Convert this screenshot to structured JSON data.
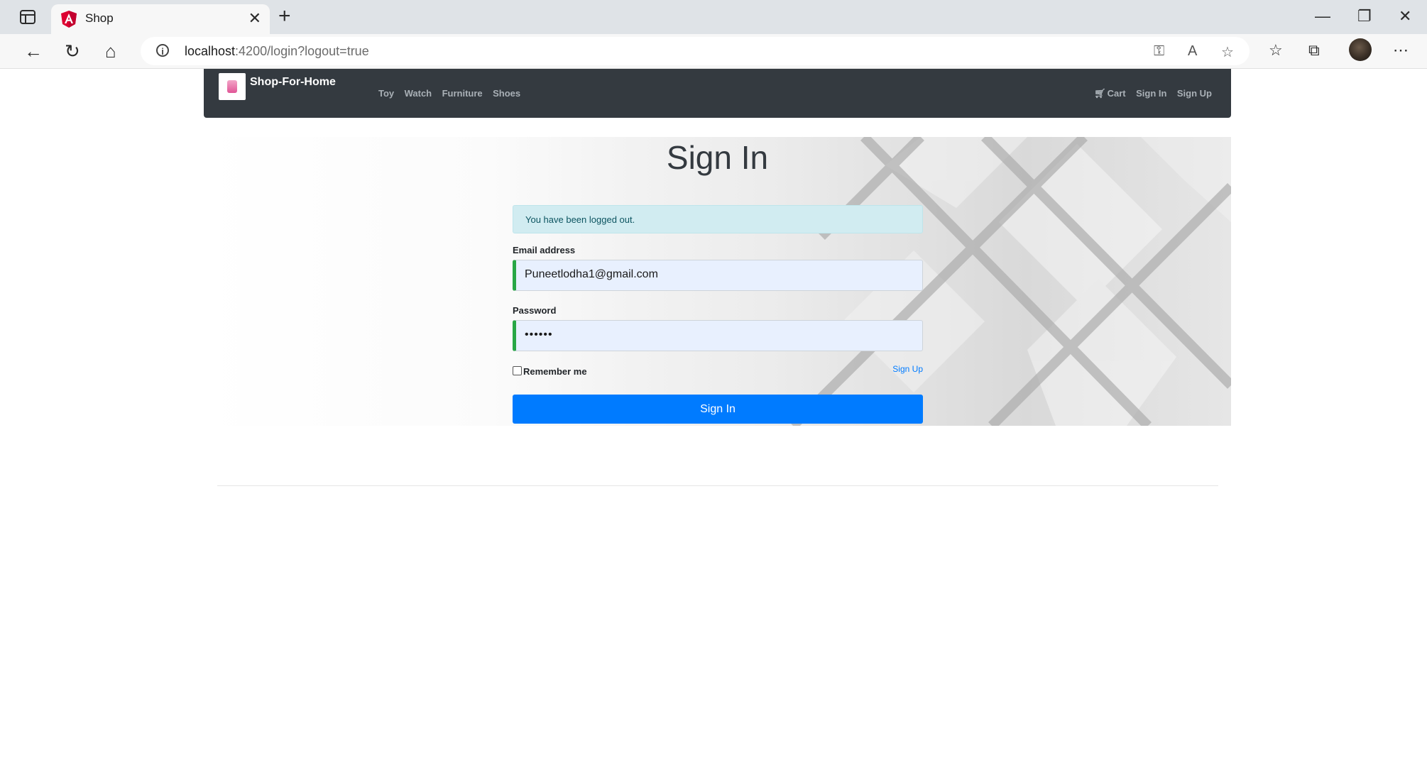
{
  "browser": {
    "tab_title": "Shop",
    "url_host": "localhost",
    "url_rest": ":4200/login?logout=true"
  },
  "navbar": {
    "brand": "Shop-For-Home",
    "links": [
      "Toy",
      "Watch",
      "Furniture",
      "Shoes"
    ],
    "right_links": {
      "cart": "Cart",
      "sign_in": "Sign In",
      "sign_up": "Sign Up"
    }
  },
  "form": {
    "title": "Sign In",
    "alert": "You have been logged out.",
    "email_label": "Email address",
    "email_value": "Puneetlodha1@gmail.com",
    "password_label": "Password",
    "password_value": "••••••",
    "remember_label": "Remember me",
    "signup_link": "Sign Up",
    "submit_label": "Sign In"
  },
  "colors": {
    "navbar_bg": "#343a40",
    "primary": "#007bff",
    "alert_bg": "#d1ecf1",
    "input_bg": "#e8f0fe",
    "valid_border": "#28a745"
  }
}
